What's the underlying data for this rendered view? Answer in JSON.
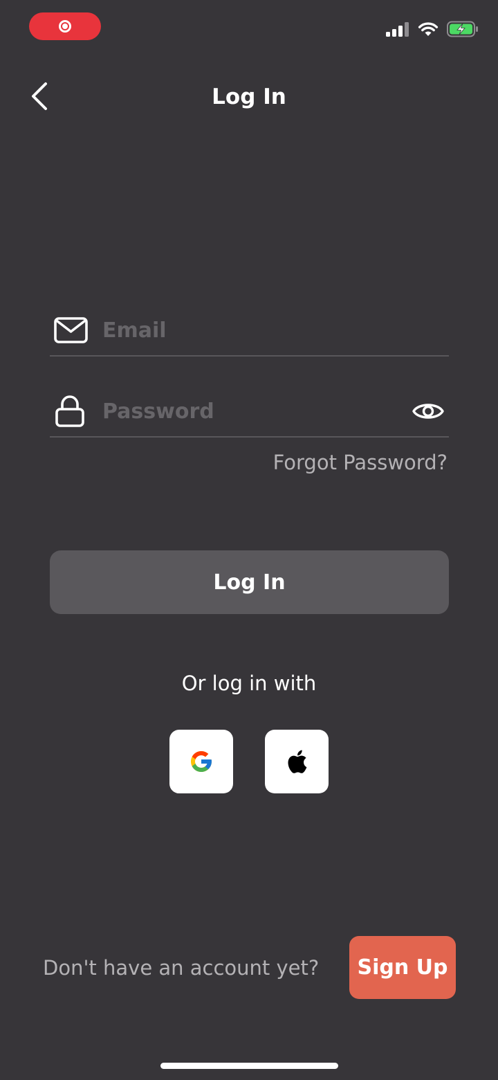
{
  "status_bar": {
    "record_icon": "screen-recording-icon",
    "signal_icon": "cellular-signal-icon",
    "wifi_icon": "wifi-icon",
    "battery_icon": "battery-charging-icon"
  },
  "header": {
    "back_icon": "chevron-left-icon",
    "title": "Log In"
  },
  "form": {
    "email": {
      "icon": "envelope-icon",
      "placeholder": "Email",
      "value": ""
    },
    "password": {
      "icon": "lock-icon",
      "placeholder": "Password",
      "value": "",
      "toggle_icon": "eye-icon"
    },
    "forgot_password": "Forgot Password?",
    "login_button": "Log In"
  },
  "social": {
    "label": "Or log in with",
    "providers": [
      {
        "name": "Google",
        "icon": "google-icon"
      },
      {
        "name": "Apple",
        "icon": "apple-icon"
      }
    ]
  },
  "footer": {
    "prompt": "Don't have an account yet?",
    "signup_button": "Sign Up"
  },
  "colors": {
    "background": "#373539",
    "accent": "#e2654f",
    "login_button": "#5a585c",
    "recording": "#e8343c",
    "battery": "#4cd964"
  }
}
